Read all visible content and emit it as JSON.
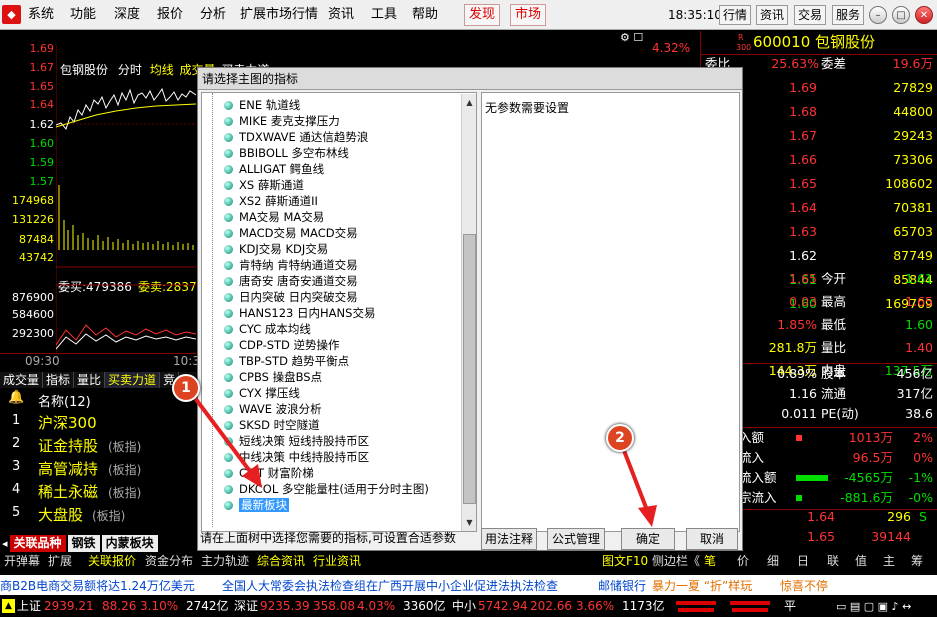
{
  "menu": {
    "items": [
      "系统",
      "功能",
      "深度",
      "报价",
      "分析",
      "扩展市场行情",
      "资讯",
      "工具",
      "帮助"
    ],
    "faxian": "发现",
    "shichang": "市场",
    "clock": "18:35:10 周日",
    "right_buttons": [
      "行情",
      "资讯",
      "交易",
      "服务"
    ]
  },
  "chart": {
    "stock_name": "包钢股份",
    "mode": "分时",
    "legend": [
      "均线",
      "成交量",
      "买卖力道"
    ],
    "pct_label": "4.32%",
    "price_labels": [
      "1.69",
      "1.67",
      "1.65",
      "1.64",
      "1.62",
      "1.60",
      "1.59",
      "1.57"
    ],
    "vol_labels": [
      "174968",
      "131226",
      "87484",
      "43742"
    ],
    "weimai": "委买:479386",
    "weimai2": "委卖:2837",
    "lower_labels": [
      "876900",
      "584600",
      "292300"
    ],
    "time_start": "09:30",
    "time_mid": "10:3",
    "sub_tabs": [
      "成交量",
      "指标",
      "量比",
      "买卖力道",
      "竞"
    ]
  },
  "sector": {
    "header": "名称(12)",
    "items": [
      {
        "n": "1",
        "name": "沪深300",
        "tag": ""
      },
      {
        "n": "2",
        "name": "证金持股",
        "tag": "(板指)"
      },
      {
        "n": "3",
        "name": "高管减持",
        "tag": "(板指)"
      },
      {
        "n": "4",
        "name": "稀土永磁",
        "tag": "(板指)"
      },
      {
        "n": "5",
        "name": "大盘股",
        "tag": "(板指)"
      }
    ],
    "tabs": [
      "关联品种",
      "钢铁",
      "内蒙板块"
    ]
  },
  "quote": {
    "code": "600010",
    "name": "包钢股份",
    "r_tag": "R",
    "num_tag": "300",
    "weibi_label": "委比",
    "weibi": "25.63%",
    "weicha_label": "委差",
    "weicha": "19.6万",
    "sell": [
      [
        "1.69",
        "27829"
      ],
      [
        "1.68",
        "44800"
      ],
      [
        "1.67",
        "29243"
      ],
      [
        "1.66",
        "73306"
      ],
      [
        "1.65",
        "108602"
      ]
    ],
    "buy": [
      [
        "1.64",
        "70381"
      ],
      [
        "1.63",
        "65703"
      ],
      [
        "1.62",
        "87749"
      ],
      [
        "1.61",
        "85844"
      ],
      [
        "1.60",
        "169709"
      ]
    ],
    "stats": [
      [
        "1.65",
        "今开",
        "1.61"
      ],
      [
        "0.03",
        "最高",
        "1.65"
      ],
      [
        "1.85%",
        "最低",
        "1.60"
      ],
      [
        "281.8万",
        "量比",
        "1.40"
      ],
      [
        "144.3万",
        "内盘",
        "137.5万"
      ]
    ],
    "stats2": [
      [
        "0.89%",
        "股本",
        "456亿"
      ],
      [
        "1.16",
        "流通",
        "317亿"
      ],
      [
        "0.011",
        "PE(动)",
        "38.6"
      ]
    ],
    "flows": [
      [
        "入额",
        "1013万",
        "2%"
      ],
      [
        "流入",
        "96.5万",
        "0%"
      ],
      [
        "流入额",
        "-4565万",
        "-1%"
      ],
      [
        "宗流入",
        "-881.6万",
        "-0%"
      ]
    ],
    "bottom": [
      [
        "1.64",
        "296",
        "S"
      ],
      [
        "1.65",
        "39144",
        ""
      ]
    ]
  },
  "dialog": {
    "title": "请选择主图的指标",
    "right_text": "无参数需要设置",
    "hint": "请在上面树中选择您需要的指标,可设置合适参数",
    "btn_usage": "用法注释",
    "btn_formula": "公式管理",
    "btn_ok": "确定",
    "btn_cancel": "取消",
    "tree": [
      "ENE 轨道线",
      "MIKE 麦克支撑压力",
      "TDXWAVE 通达信趋势浪",
      "BBIBOLL 多空布林线",
      "ALLIGAT 鳄鱼线",
      "XS 薛斯通道",
      "XS2 薛斯通道II",
      "MA交易 MA交易",
      "MACD交易 MACD交易",
      "KDJ交易 KDJ交易",
      "肯特纳 肯特纳通道交易",
      "唐奇安 唐奇安通道交易",
      "日内突破 日内突破交易",
      "HANS123 日内HANS交易",
      "CYC 成本均线",
      "CDP-STD 逆势操作",
      "TBP-STD 趋势平衡点",
      "CPBS 操盘BS点",
      "CYX 撑压线",
      "WAVE 波浪分析",
      "SKSD 时空隧道",
      "短线决策 短线持股持币区",
      "中线决策 中线持股持币区",
      "CFJT 财富阶梯",
      "DKCOL 多空能量柱(适用于分时主图)",
      "最新板块"
    ]
  },
  "badges": [
    "1",
    "2"
  ],
  "statusbar": {
    "items": [
      "开弹幕",
      "扩展",
      "关联报价",
      "资金分布",
      "主力轨迹",
      "综合资讯",
      "行业资讯"
    ],
    "right": [
      "图文F10",
      "侧边栏《",
      "笔",
      "价",
      "细",
      "日",
      "联",
      "值",
      "主",
      "筹"
    ]
  },
  "ticker": {
    "t1": "商B2B电商交易额将达1.24万亿美元",
    "t2": "全国人大常委会执法检查组在广西开展中小企业促进法执法检查",
    "t3": "邮储银行",
    "t4": "暴力一夏 “折”样玩",
    "t5": "惊喜不停"
  },
  "index": {
    "sh_label": "上证",
    "sh": "2939.21",
    "sh_ch": "88.26",
    "sh_pct": "3.10%",
    "sh_amt": "2742亿",
    "sz_label": "深证",
    "sz": "9235.39",
    "sz_ch": "358.08",
    "sz_pct": "4.03%",
    "sz_amt": "3360亿",
    "zx_label": "中小",
    "zx": "5742.94",
    "zx_ch": "202.66",
    "zx_pct": "3.66%",
    "zx_amt": "1173亿",
    "ping": "平"
  }
}
